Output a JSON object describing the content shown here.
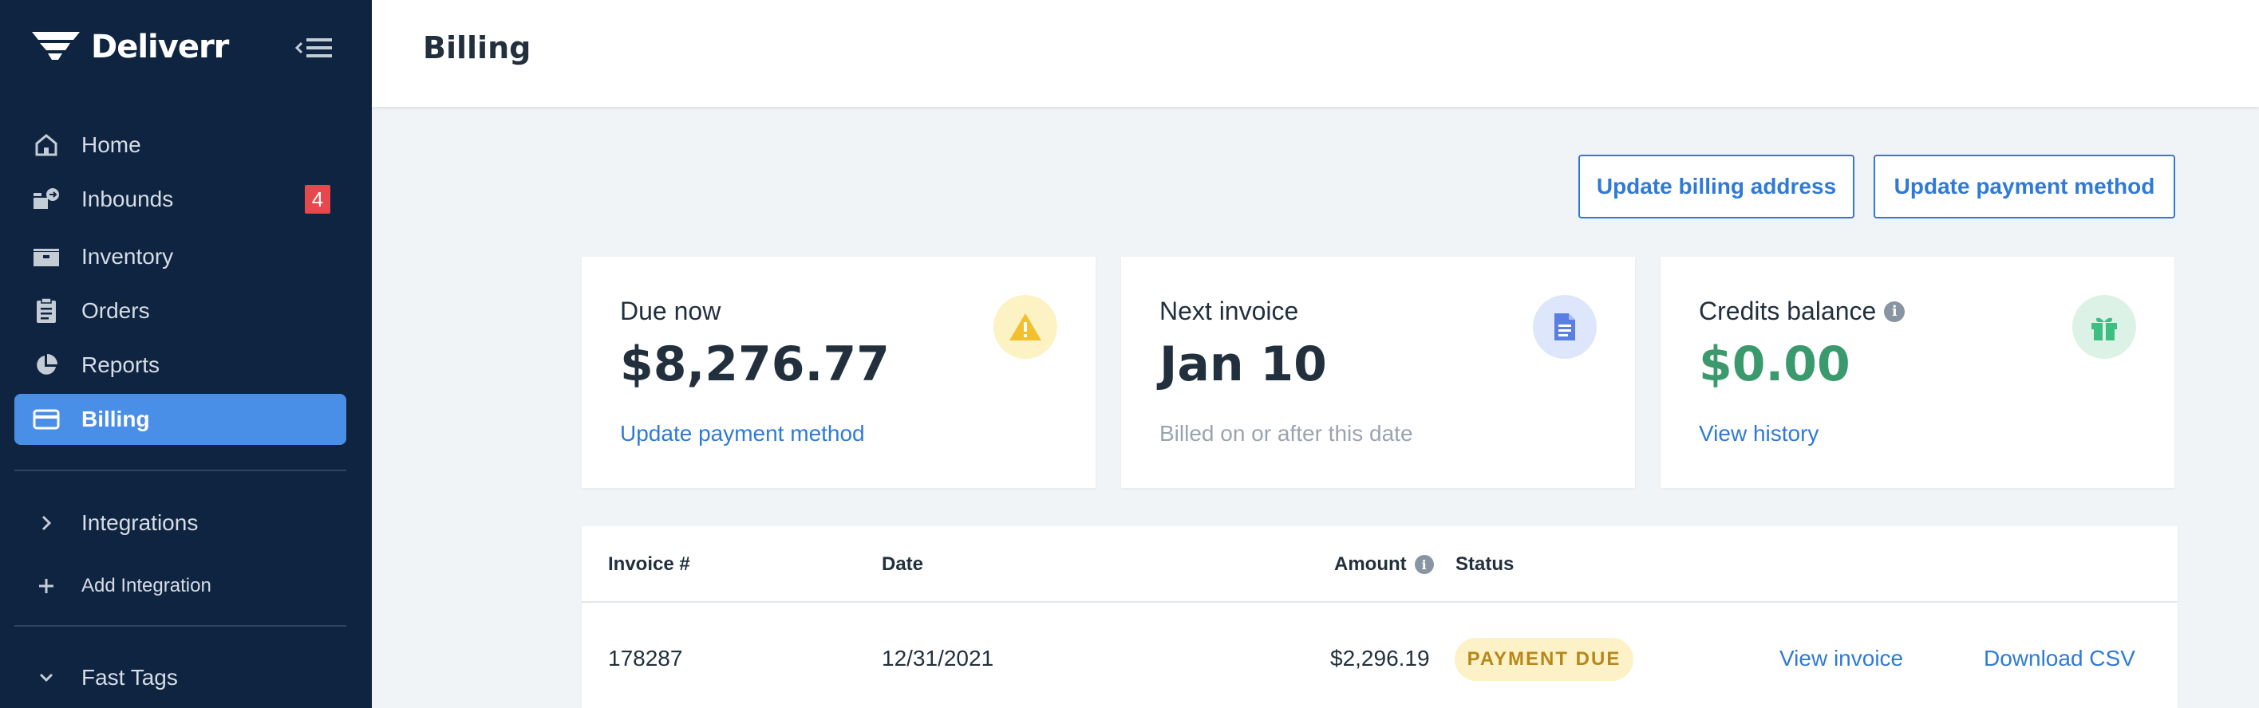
{
  "brand": {
    "name": "Deliverr"
  },
  "sidebar": {
    "items": [
      {
        "label": "Home",
        "icon": "home-icon"
      },
      {
        "label": "Inbounds",
        "icon": "inbounds-icon",
        "badge": "4"
      },
      {
        "label": "Inventory",
        "icon": "inventory-icon"
      },
      {
        "label": "Orders",
        "icon": "orders-icon"
      },
      {
        "label": "Reports",
        "icon": "reports-icon"
      },
      {
        "label": "Billing",
        "icon": "billing-icon",
        "active": true
      }
    ],
    "integrations_label": "Integrations",
    "add_integration_label": "Add Integration",
    "fast_tags_label": "Fast Tags"
  },
  "header": {
    "title": "Billing"
  },
  "actions": {
    "update_billing_address": "Update billing address",
    "update_payment_method": "Update payment method"
  },
  "cards": {
    "due_now": {
      "title": "Due now",
      "value": "$8,276.77",
      "link": "Update payment method",
      "icon": "warning-icon"
    },
    "next_invoice": {
      "title": "Next invoice",
      "value": "Jan 10",
      "subtext": "Billed on or after this date",
      "icon": "document-icon"
    },
    "credits": {
      "title": "Credits balance",
      "value": "$0.00",
      "link": "View history",
      "icon": "gift-icon"
    }
  },
  "table": {
    "columns": {
      "invoice": "Invoice #",
      "date": "Date",
      "amount": "Amount",
      "status": "Status"
    },
    "rows": [
      {
        "invoice": "178287",
        "date": "12/31/2021",
        "amount": "$2,296.19",
        "status": "PAYMENT DUE",
        "view": "View invoice",
        "download": "Download CSV"
      }
    ]
  },
  "colors": {
    "sidebar_bg": "#0f2440",
    "accent": "#4a8fe7",
    "link": "#2f7ad8",
    "credits_green": "#3a9a6e",
    "badge_red": "#e5484d",
    "status_due_bg": "#fdf1c7",
    "status_due_text": "#b7871a"
  }
}
